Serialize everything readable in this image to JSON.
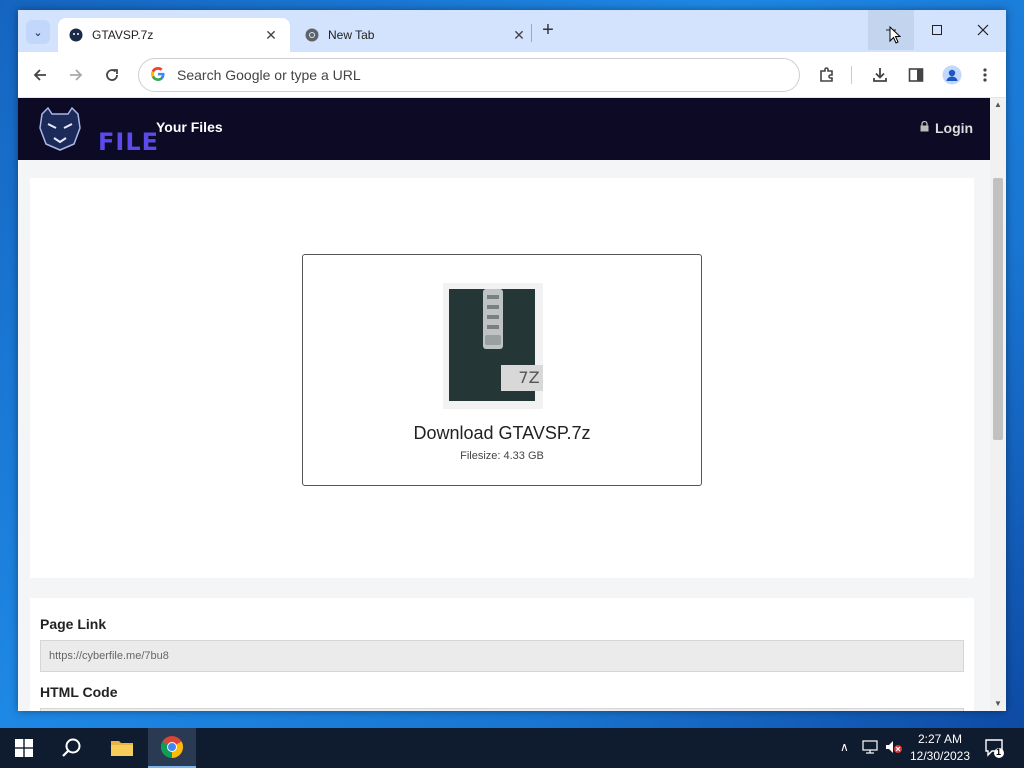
{
  "browser": {
    "tabs": [
      {
        "title": "GTAVSP.7z",
        "active": true
      },
      {
        "title": "New Tab",
        "active": false
      }
    ],
    "omnibox": {
      "placeholder": "Search Google or type a URL"
    }
  },
  "site": {
    "nav": {
      "your_files": "Your Files",
      "login": "Login"
    },
    "logo_text": "FILE",
    "download": {
      "file_badge": "7Z",
      "title": "Download GTAVSP.7z",
      "filesize": "Filesize: 4.33 GB"
    },
    "page_link": {
      "label": "Page Link",
      "value": "https://cyberfile.me/7bu8"
    },
    "html_code": {
      "label": "HTML Code"
    }
  },
  "taskbar": {
    "time": "2:27 AM",
    "date": "12/30/2023",
    "notification_count": "1"
  },
  "colors": {
    "header_bg": "#0c0a24",
    "logo_purple": "#5c4bea",
    "tabstrip_bg": "#d3e3fd"
  }
}
